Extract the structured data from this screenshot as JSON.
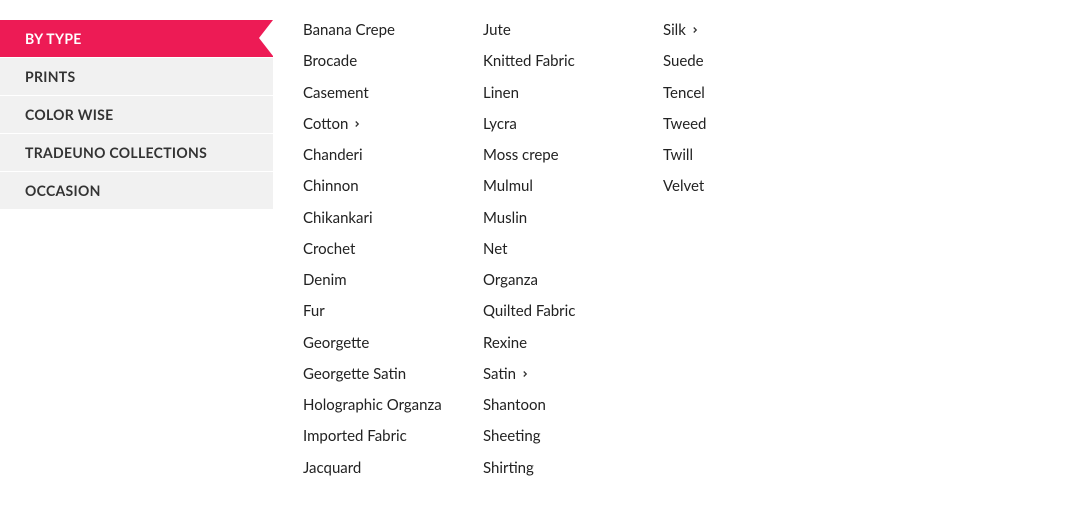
{
  "sidebar": {
    "items": [
      {
        "label": "BY TYPE",
        "active": true
      },
      {
        "label": "PRINTS",
        "active": false
      },
      {
        "label": "COLOR WISE",
        "active": false
      },
      {
        "label": "TRADEUNO COLLECTIONS",
        "active": false
      },
      {
        "label": "OCCASION",
        "active": false
      }
    ]
  },
  "columns": [
    [
      {
        "label": "Banana Crepe",
        "hasSub": false
      },
      {
        "label": "Brocade",
        "hasSub": false
      },
      {
        "label": "Casement",
        "hasSub": false
      },
      {
        "label": "Cotton",
        "hasSub": true
      },
      {
        "label": "Chanderi",
        "hasSub": false
      },
      {
        "label": "Chinnon",
        "hasSub": false
      },
      {
        "label": "Chikankari",
        "hasSub": false
      },
      {
        "label": "Crochet",
        "hasSub": false
      },
      {
        "label": "Denim",
        "hasSub": false
      },
      {
        "label": "Fur",
        "hasSub": false
      },
      {
        "label": "Georgette",
        "hasSub": false
      },
      {
        "label": "Georgette Satin",
        "hasSub": false
      },
      {
        "label": "Holographic Organza",
        "hasSub": false
      },
      {
        "label": "Imported Fabric",
        "hasSub": false
      },
      {
        "label": "Jacquard",
        "hasSub": false
      }
    ],
    [
      {
        "label": "Jute",
        "hasSub": false
      },
      {
        "label": "Knitted Fabric",
        "hasSub": false
      },
      {
        "label": "Linen",
        "hasSub": false
      },
      {
        "label": "Lycra",
        "hasSub": false
      },
      {
        "label": "Moss crepe",
        "hasSub": false
      },
      {
        "label": "Mulmul",
        "hasSub": false
      },
      {
        "label": "Muslin",
        "hasSub": false
      },
      {
        "label": "Net",
        "hasSub": false
      },
      {
        "label": "Organza",
        "hasSub": false
      },
      {
        "label": "Quilted Fabric",
        "hasSub": false
      },
      {
        "label": "Rexine",
        "hasSub": false
      },
      {
        "label": "Satin",
        "hasSub": true
      },
      {
        "label": "Shantoon",
        "hasSub": false
      },
      {
        "label": "Sheeting",
        "hasSub": false
      },
      {
        "label": "Shirting",
        "hasSub": false
      }
    ],
    [
      {
        "label": "Silk",
        "hasSub": true
      },
      {
        "label": "Suede",
        "hasSub": false
      },
      {
        "label": "Tencel",
        "hasSub": false
      },
      {
        "label": "Tweed",
        "hasSub": false
      },
      {
        "label": "Twill",
        "hasSub": false
      },
      {
        "label": "Velvet",
        "hasSub": false
      }
    ]
  ]
}
